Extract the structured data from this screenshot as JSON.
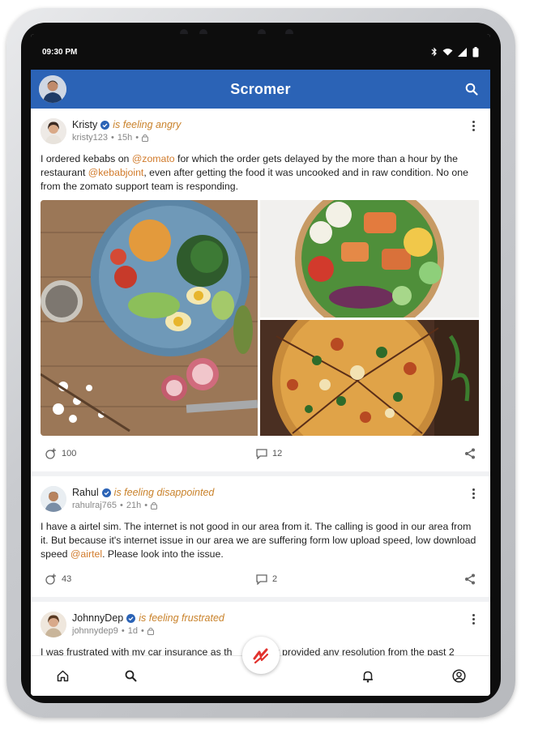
{
  "status_bar": {
    "time": "09:30 PM"
  },
  "app": {
    "brand": "Scromer",
    "accent": "#2b63b6",
    "mention_color": "#d17a2a",
    "feeling_color": "#c9822b"
  },
  "posts": [
    {
      "name": "Kristy",
      "feeling": "is feeling angry",
      "handle": "kristy123",
      "time": "15h",
      "body_prefix": "I ordered kebabs on ",
      "mention1": "@zomato",
      "body_mid": " for which the order gets delayed by the more than a hour by the restaurant ",
      "mention2": "@kebabjoint",
      "body_suffix": ", even after getting the food it was uncooked and in raw condition. No one from the zomato support team is responding.",
      "likes": "100",
      "comments": "12"
    },
    {
      "name": "Rahul",
      "feeling": "is feeling disappointed",
      "handle": "rahulraj765",
      "time": "21h",
      "body_prefix": "I have a airtel sim. The internet is not good in our area from it.  The calling is good in our area from it. But because it's internet  issue in our area we are suffering form low upload speed, low download speed ",
      "mention1": "@airtel",
      "body_suffix": ". Please look into the issue.",
      "likes": "43",
      "comments": "2"
    },
    {
      "name": "JohnnyDep",
      "feeling": "is feeling frustrated",
      "handle": "johnnydep9",
      "time": "1d",
      "body_prefix": "I was frustrated with my car insurance as th",
      "body_suffix": "nt provided any resolution from the past 2"
    }
  ],
  "icons": {
    "search": "search-icon",
    "home": "home-icon",
    "notifications": "bell-icon",
    "profile": "profile-icon",
    "compose": "scromer-logo-icon"
  }
}
